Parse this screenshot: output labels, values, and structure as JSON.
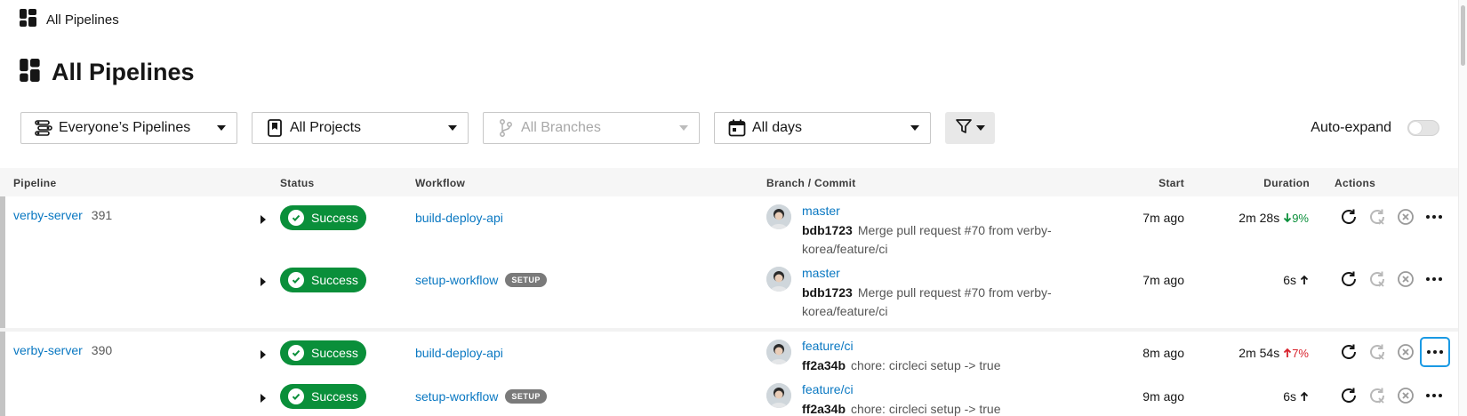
{
  "topbar": {
    "title": "All Pipelines",
    "icon": "dashboard-icon"
  },
  "page": {
    "title": "All Pipelines",
    "icon": "dashboard-icon"
  },
  "filters": {
    "pipelines": {
      "label": "Everyone’s Pipelines",
      "icon": "pipelines-icon"
    },
    "projects": {
      "label": "All Projects",
      "icon": "bookmark-icon"
    },
    "branches": {
      "label": "All Branches",
      "icon": "branch-icon",
      "disabled": true
    },
    "days": {
      "label": "All days",
      "icon": "calendar-icon"
    },
    "filter_button": {
      "icon": "funnel-icon"
    }
  },
  "auto_expand": {
    "label": "Auto-expand",
    "enabled": false
  },
  "columns": {
    "pipeline": "Pipeline",
    "status": "Status",
    "workflow": "Workflow",
    "branch_commit": "Branch / Commit",
    "start": "Start",
    "duration": "Duration",
    "actions": "Actions"
  },
  "groups": [
    {
      "project": "verby-server",
      "number": "391",
      "rows": [
        {
          "status": "Success",
          "workflow": "build-deploy-api",
          "tag": "",
          "branch": "master",
          "sha": "bdb1723",
          "message": "Merge pull request #70 from verby-korea/feature/ci",
          "start": "7m ago",
          "duration": "2m 28s",
          "trend": "9%",
          "trend_dir": "down"
        },
        {
          "status": "Success",
          "workflow": "setup-workflow",
          "tag": "SETUP",
          "branch": "master",
          "sha": "bdb1723",
          "message": "Merge pull request #70 from verby-korea/feature/ci",
          "start": "7m ago",
          "duration": "6s",
          "trend": "",
          "trend_dir": "up"
        }
      ]
    },
    {
      "project": "verby-server",
      "number": "390",
      "rows": [
        {
          "status": "Success",
          "workflow": "build-deploy-api",
          "tag": "",
          "branch": "feature/ci",
          "sha": "ff2a34b",
          "message": "chore: circleci setup -> true",
          "start": "8m ago",
          "duration": "2m 54s",
          "trend": "7%",
          "trend_dir": "up"
        },
        {
          "status": "Success",
          "workflow": "setup-workflow",
          "tag": "SETUP",
          "branch": "feature/ci",
          "sha": "ff2a34b",
          "message": "chore: circleci setup -> true",
          "start": "9m ago",
          "duration": "6s",
          "trend": "",
          "trend_dir": "up"
        }
      ]
    }
  ],
  "row_actions": [
    "rerun-icon",
    "rerun-failed-icon",
    "cancel-icon",
    "more-icon"
  ],
  "colors": {
    "link": "#0a78c2",
    "success": "#0a8f3a",
    "trend_up": "#d8222c",
    "trend_down": "#0a8f3a",
    "focus": "#1a9ae4"
  }
}
